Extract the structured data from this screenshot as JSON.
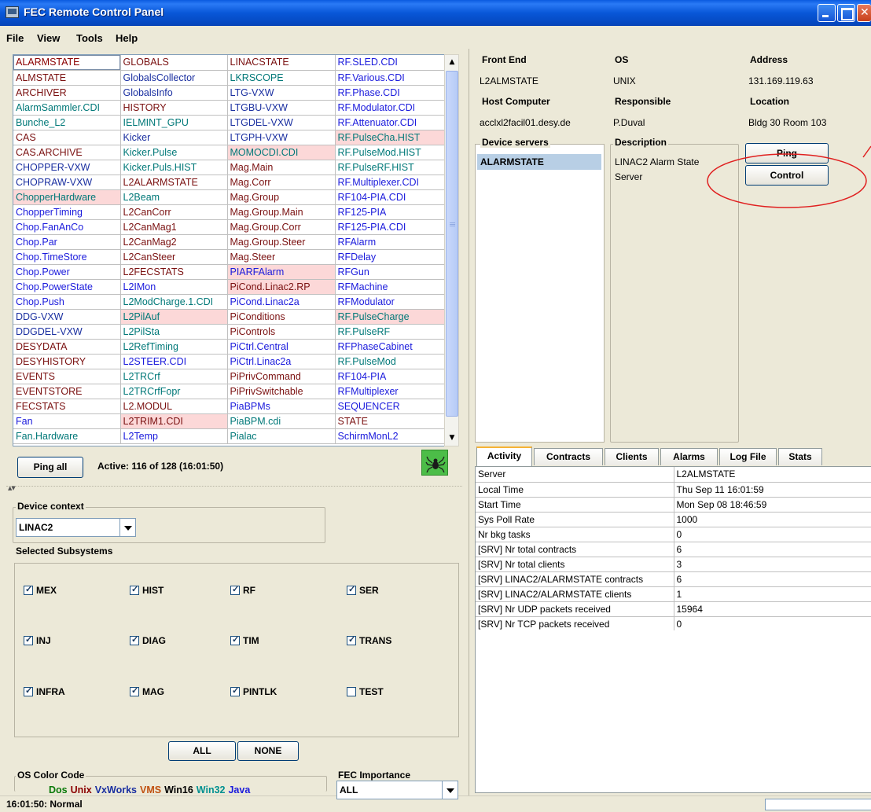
{
  "window": {
    "title": "FEC Remote Control Panel"
  },
  "menu": [
    "File",
    "View",
    "Tools",
    "Help"
  ],
  "colors": {
    "titlebar": "#0857d8",
    "unix": "#8b0000",
    "vxworks": "#1a2fa0",
    "vms": "#c05010",
    "win32": "#009090",
    "java": "#1a1adc",
    "dos": "#0a7a0a",
    "win16": "#000000",
    "highlight": "#fcd8d8",
    "annotation": "#e02020"
  },
  "grid": {
    "rows": [
      [
        [
          "ALARMSTATE",
          "unix",
          0,
          1
        ],
        [
          "GLOBALS",
          "vms",
          0,
          0
        ],
        [
          "LINACSTATE",
          "vms",
          0,
          0
        ],
        [
          "RF.SLED.CDI",
          "java",
          0,
          0
        ]
      ],
      [
        [
          "ALMSTATE",
          "vms",
          0,
          0
        ],
        [
          "GlobalsCollector",
          "vx",
          0,
          0
        ],
        [
          "LKRSCOPE",
          "win",
          0,
          0
        ],
        [
          "RF.Various.CDI",
          "java",
          0,
          0
        ]
      ],
      [
        [
          "ARCHIVER",
          "vms",
          0,
          0
        ],
        [
          "GlobalsInfo",
          "vx",
          0,
          0
        ],
        [
          "LTG-VXW",
          "vx",
          0,
          0
        ],
        [
          "RF.Phase.CDI",
          "java",
          0,
          0
        ]
      ],
      [
        [
          "AlarmSammler.CDI",
          "win",
          0,
          0
        ],
        [
          "HISTORY",
          "vms",
          0,
          0
        ],
        [
          "LTGBU-VXW",
          "vx",
          0,
          0
        ],
        [
          "RF.Modulator.CDI",
          "java",
          0,
          0
        ]
      ],
      [
        [
          "Bunche_L2",
          "win",
          0,
          0
        ],
        [
          "IELMINT_GPU",
          "win",
          0,
          0
        ],
        [
          "LTGDEL-VXW",
          "vx",
          0,
          0
        ],
        [
          "RF.Attenuator.CDI",
          "java",
          0,
          0
        ]
      ],
      [
        [
          "CAS",
          "vms",
          0,
          0
        ],
        [
          "Kicker",
          "vx",
          0,
          0
        ],
        [
          "LTGPH-VXW",
          "vx",
          0,
          0
        ],
        [
          "RF.PulseCha.HIST",
          "win",
          1,
          0
        ]
      ],
      [
        [
          "CAS.ARCHIVE",
          "vms",
          0,
          0
        ],
        [
          "Kicker.Pulse",
          "win",
          0,
          0
        ],
        [
          "MOMOCDI.CDI",
          "win",
          1,
          0
        ],
        [
          "RF.PulseMod.HIST",
          "win",
          0,
          0
        ]
      ],
      [
        [
          "CHOPPER-VXW",
          "vx",
          0,
          0
        ],
        [
          "Kicker.Puls.HIST",
          "win",
          0,
          0
        ],
        [
          "Mag.Main",
          "vms",
          0,
          0
        ],
        [
          "RF.PulseRF.HIST",
          "win",
          0,
          0
        ]
      ],
      [
        [
          "CHOPRAW-VXW",
          "vx",
          0,
          0
        ],
        [
          "L2ALARMSTATE",
          "vms",
          0,
          0
        ],
        [
          "Mag.Corr",
          "vms",
          0,
          0
        ],
        [
          "RF.Multiplexer.CDI",
          "java",
          0,
          0
        ]
      ],
      [
        [
          "ChopperHardware",
          "win",
          1,
          0
        ],
        [
          "L2Beam",
          "win",
          0,
          0
        ],
        [
          "Mag.Group",
          "vms",
          0,
          0
        ],
        [
          "RF104-PIA.CDI",
          "java",
          0,
          0
        ]
      ],
      [
        [
          "ChopperTiming",
          "java",
          0,
          0
        ],
        [
          "L2CanCorr",
          "vms",
          0,
          0
        ],
        [
          "Mag.Group.Main",
          "vms",
          0,
          0
        ],
        [
          "RF125-PIA",
          "java",
          0,
          0
        ]
      ],
      [
        [
          "Chop.FanAnCo",
          "java",
          0,
          0
        ],
        [
          "L2CanMag1",
          "vms",
          0,
          0
        ],
        [
          "Mag.Group.Corr",
          "vms",
          0,
          0
        ],
        [
          "RF125-PIA.CDI",
          "java",
          0,
          0
        ]
      ],
      [
        [
          "Chop.Par",
          "java",
          0,
          0
        ],
        [
          "L2CanMag2",
          "vms",
          0,
          0
        ],
        [
          "Mag.Group.Steer",
          "vms",
          0,
          0
        ],
        [
          "RFAlarm",
          "java",
          0,
          0
        ]
      ],
      [
        [
          "Chop.TimeStore",
          "java",
          0,
          0
        ],
        [
          "L2CanSteer",
          "vms",
          0,
          0
        ],
        [
          "Mag.Steer",
          "vms",
          0,
          0
        ],
        [
          "RFDelay",
          "java",
          0,
          0
        ]
      ],
      [
        [
          "Chop.Power",
          "java",
          0,
          0
        ],
        [
          "L2FECSTATS",
          "vms",
          0,
          0
        ],
        [
          "PIARFAlarm",
          "java",
          1,
          0
        ],
        [
          "RFGun",
          "java",
          0,
          0
        ]
      ],
      [
        [
          "Chop.PowerState",
          "java",
          0,
          0
        ],
        [
          "L2IMon",
          "java",
          0,
          0
        ],
        [
          "PiCond.Linac2.RP",
          "vms",
          1,
          0
        ],
        [
          "RFMachine",
          "java",
          0,
          0
        ]
      ],
      [
        [
          "Chop.Push",
          "java",
          0,
          0
        ],
        [
          "L2ModCharge.1.CDI",
          "win",
          0,
          0
        ],
        [
          "PiCond.Linac2a",
          "java",
          0,
          0
        ],
        [
          "RFModulator",
          "java",
          0,
          0
        ]
      ],
      [
        [
          "DDG-VXW",
          "vx",
          0,
          0
        ],
        [
          "L2PilAuf",
          "win",
          1,
          0
        ],
        [
          "PiConditions",
          "vms",
          0,
          0
        ],
        [
          "RF.PulseCharge",
          "win",
          1,
          0
        ]
      ],
      [
        [
          "DDGDEL-VXW",
          "vx",
          0,
          0
        ],
        [
          "L2PilSta",
          "win",
          0,
          0
        ],
        [
          "PiControls",
          "vms",
          0,
          0
        ],
        [
          "RF.PulseRF",
          "win",
          0,
          0
        ]
      ],
      [
        [
          "DESYDATA",
          "vms",
          0,
          0
        ],
        [
          "L2RefTiming",
          "win",
          0,
          0
        ],
        [
          "PiCtrl.Central",
          "java",
          0,
          0
        ],
        [
          "RFPhaseCabinet",
          "java",
          0,
          0
        ]
      ],
      [
        [
          "DESYHISTORY",
          "vms",
          0,
          0
        ],
        [
          "L2STEER.CDI",
          "java",
          0,
          0
        ],
        [
          "PiCtrl.Linac2a",
          "java",
          0,
          0
        ],
        [
          "RF.PulseMod",
          "win",
          0,
          0
        ]
      ],
      [
        [
          "EVENTS",
          "vms",
          0,
          0
        ],
        [
          "L2TRCrf",
          "win",
          0,
          0
        ],
        [
          "PiPrivCommand",
          "vms",
          0,
          0
        ],
        [
          "RF104-PIA",
          "java",
          0,
          0
        ]
      ],
      [
        [
          "EVENTSTORE",
          "vms",
          0,
          0
        ],
        [
          "L2TRCrfFopr",
          "win",
          0,
          0
        ],
        [
          "PiPrivSwitchable",
          "vms",
          0,
          0
        ],
        [
          "RFMultiplexer",
          "java",
          0,
          0
        ]
      ],
      [
        [
          "FECSTATS",
          "vms",
          0,
          0
        ],
        [
          "L2.MODUL",
          "vms",
          0,
          0
        ],
        [
          "PiaBPMs",
          "java",
          0,
          0
        ],
        [
          "SEQUENCER",
          "java",
          0,
          0
        ]
      ],
      [
        [
          "Fan",
          "java",
          0,
          0
        ],
        [
          "L2TRIM1.CDI",
          "vms",
          1,
          0
        ],
        [
          "PiaBPM.cdi",
          "win",
          0,
          0
        ],
        [
          "STATE",
          "vms",
          0,
          0
        ]
      ],
      [
        [
          "Fan.Hardware",
          "win",
          0,
          0
        ],
        [
          "L2Temp",
          "java",
          0,
          0
        ],
        [
          "Pialac",
          "win",
          0,
          0
        ],
        [
          "SchirmMonL2",
          "java",
          0,
          0
        ]
      ]
    ]
  },
  "ping_all": {
    "label": "Ping all",
    "status": "Active: 116 of 128  (16:01:50)"
  },
  "device_context": {
    "title": "Device context",
    "value": "LINAC2"
  },
  "subsystems": {
    "title": "Selected Subsystems",
    "items": [
      {
        "label": "MEX",
        "checked": true
      },
      {
        "label": "HIST",
        "checked": true
      },
      {
        "label": "RF",
        "checked": true
      },
      {
        "label": "SER",
        "checked": true
      },
      {
        "label": "INJ",
        "checked": true
      },
      {
        "label": "DIAG",
        "checked": true
      },
      {
        "label": "TIM",
        "checked": true
      },
      {
        "label": "TRANS",
        "checked": true
      },
      {
        "label": "INFRA",
        "checked": true
      },
      {
        "label": "MAG",
        "checked": true
      },
      {
        "label": "PINTLK",
        "checked": true
      },
      {
        "label": "TEST",
        "checked": false
      }
    ],
    "all_label": "ALL",
    "none_label": "NONE"
  },
  "os_color_code": {
    "title": "OS Color Code",
    "items": [
      "Dos",
      "Unix",
      "VxWorks",
      "VMS",
      "Win16",
      "Win32",
      "Java"
    ]
  },
  "fec_importance": {
    "title": "FEC Importance",
    "value": "ALL"
  },
  "info": {
    "front_end": {
      "title": "Front End",
      "value": "L2ALMSTATE"
    },
    "os": {
      "title": "OS",
      "value": "UNIX"
    },
    "address": {
      "title": "Address",
      "value": "131.169.119.63"
    },
    "host": {
      "title": "Host Computer",
      "value": "acclxl2facil01.desy.de"
    },
    "responsible": {
      "title": "Responsible",
      "value": "P.Duval"
    },
    "location": {
      "title": "Location",
      "value": "Bldg 30 Room 103"
    },
    "device_servers": {
      "title": "Device servers",
      "selected": "ALARMSTATE"
    },
    "description": {
      "title": "Description",
      "value_line1": "LINAC2 Alarm State",
      "value_line2": "Server"
    },
    "ping_label": "Ping",
    "control_label": "Control"
  },
  "tabs": [
    "Activity",
    "Contracts",
    "Clients",
    "Alarms",
    "Log File",
    "Stats"
  ],
  "activity": [
    [
      "Server",
      "L2ALMSTATE"
    ],
    [
      "Local Time",
      "Thu Sep 11 16:01:59"
    ],
    [
      "Start Time",
      "Mon Sep 08 18:46:59"
    ],
    [
      "Sys Poll Rate",
      "1000"
    ],
    [
      "Nr bkg tasks",
      "0"
    ],
    [
      "[SRV] Nr total contracts",
      "6"
    ],
    [
      "[SRV] Nr total clients",
      "3"
    ],
    [
      "[SRV] LINAC2/ALARMSTATE contracts",
      "6"
    ],
    [
      "[SRV] LINAC2/ALARMSTATE clients",
      "1"
    ],
    [
      "[SRV] Nr UDP packets received",
      "15964"
    ],
    [
      "[SRV] Nr TCP packets received",
      "0"
    ]
  ],
  "status": {
    "text": "16:01:50: Normal"
  }
}
